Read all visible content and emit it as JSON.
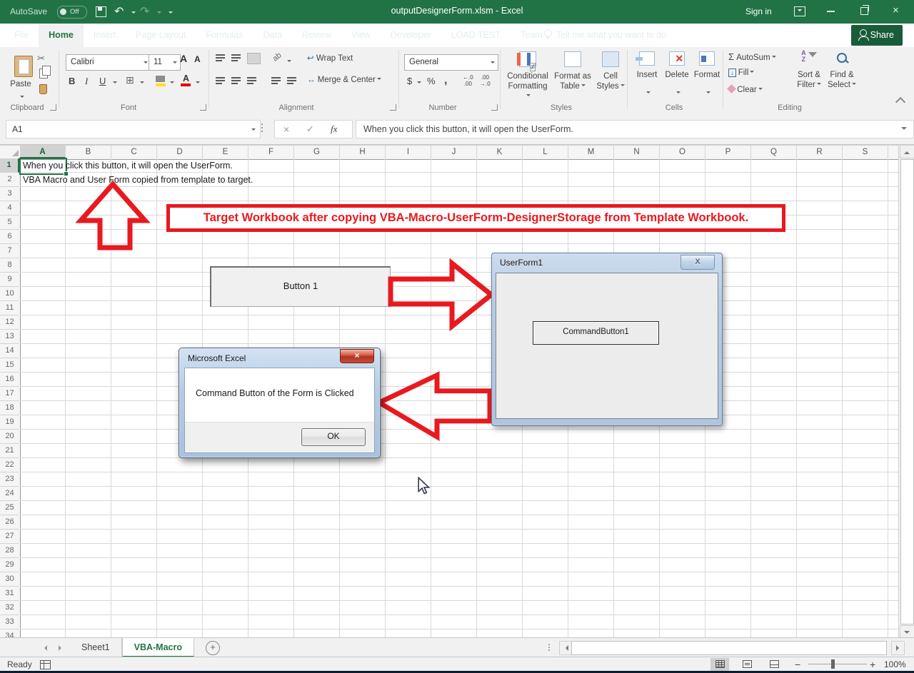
{
  "titlebar": {
    "autosave_label": "AutoSave",
    "autosave_state": "Off",
    "title": "outputDesignerForm.xlsm  -  Excel",
    "sign_in": "Sign in"
  },
  "ribbon_tabs": [
    {
      "label": "File",
      "active": false
    },
    {
      "label": "Home",
      "active": true
    },
    {
      "label": "Insert",
      "active": false
    },
    {
      "label": "Page Layout",
      "active": false
    },
    {
      "label": "Formulas",
      "active": false
    },
    {
      "label": "Data",
      "active": false
    },
    {
      "label": "Review",
      "active": false
    },
    {
      "label": "View",
      "active": false
    },
    {
      "label": "Developer",
      "active": false
    },
    {
      "label": "LOAD TEST",
      "active": false
    },
    {
      "label": "Team",
      "active": false
    }
  ],
  "tell_me": "Tell me what you want to do",
  "share_label": "Share",
  "ribbon": {
    "groups": [
      "Clipboard",
      "Font",
      "Alignment",
      "Number",
      "Styles",
      "Cells",
      "Editing"
    ],
    "paste": "Paste",
    "font_name": "Calibri",
    "font_size": "11",
    "bold": "B",
    "italic": "I",
    "underline": "U",
    "wrap_text": "Wrap Text",
    "merge_center": "Merge & Center",
    "number_format": "General",
    "currency": "$",
    "percent": "%",
    "comma": ",",
    "inc_dec_a": "←.0",
    "inc_dec_b": ".00",
    "dec_dec_a": ".00",
    "dec_dec_b": "→.0",
    "cond_l1": "Conditional",
    "cond_l2": "Formatting",
    "fmt_tbl_l1": "Format as",
    "fmt_tbl_l2": "Table",
    "cell_styles_l1": "Cell",
    "cell_styles_l2": "Styles",
    "insert": "Insert",
    "delete": "Delete",
    "format": "Format",
    "autosum": "AutoSum",
    "fill": "Fill",
    "clear": "Clear",
    "sort_l1": "Sort &",
    "sort_l2": "Filter",
    "find_l1": "Find &",
    "find_l2": "Select",
    "orientation": "ab"
  },
  "formula_bar": {
    "name_box": "A1",
    "fx_label": "fx",
    "content": "When you click this button, it will open the UserForm."
  },
  "grid": {
    "columns": [
      "A",
      "B",
      "C",
      "D",
      "E",
      "F",
      "G",
      "H",
      "I",
      "J",
      "K",
      "L",
      "M",
      "N",
      "O",
      "P",
      "Q",
      "R",
      "S"
    ],
    "row_count": 34,
    "selected_cell": "A1",
    "selected_column": "A",
    "selected_row": 1,
    "cells": {
      "A1": "When you click this button, it will open the UserForm.",
      "A2": "VBA Macro and User Form copied from template to target."
    }
  },
  "annotations": {
    "banner_text": "Target Workbook after copying VBA-Macro-UserForm-DesignerStorage from Template Workbook.",
    "accent_red": "#e8191f"
  },
  "sheet_button": {
    "label": "Button 1"
  },
  "userform": {
    "title": "UserForm1",
    "close_glyph": "X",
    "command_button": "CommandButton1"
  },
  "dialog": {
    "title": "Microsoft Excel",
    "close_glyph": "×",
    "message": "Command Button of the Form is Clicked",
    "ok_label": "OK"
  },
  "sheet_tabs": {
    "tabs": [
      {
        "label": "Sheet1",
        "active": false
      },
      {
        "label": "VBA-Macro",
        "active": true
      }
    ],
    "add_glyph": "+"
  },
  "status_bar": {
    "ready": "Ready",
    "zoom_level": "100%",
    "zoom_minus": "−",
    "zoom_plus": "+"
  },
  "icons": {
    "undo": "↶",
    "redo": "↷",
    "scissors": "✂",
    "sigma": "Σ",
    "fill_arrow": "↓",
    "wrap_arrow": "↩",
    "merge_arrow": "↔",
    "check": "✓",
    "cancel": "×",
    "borders": "⊞",
    "not_equal": "≠",
    "delete_x": "×",
    "sort_a": "A",
    "sort_z": "Z",
    "font_up": "A",
    "font_down": "A"
  }
}
